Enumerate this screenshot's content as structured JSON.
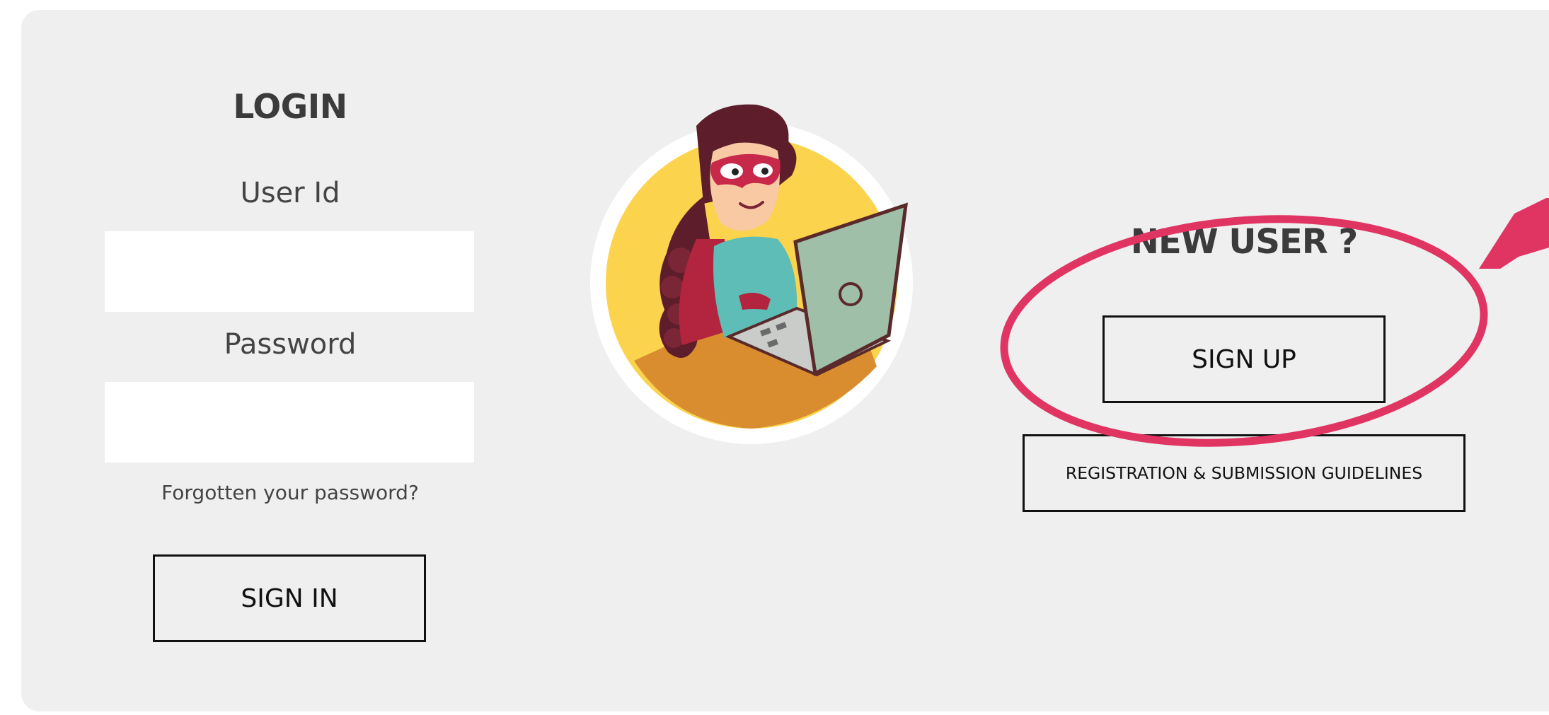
{
  "login": {
    "title": "LOGIN",
    "user_id_label": "User Id",
    "user_id_value": "",
    "password_label": "Password",
    "password_value": "",
    "forgot_password": "Forgotten your password?",
    "sign_in": "SIGN IN"
  },
  "new_user": {
    "title": "NEW USER ?",
    "sign_up": "SIGN UP",
    "guidelines": "REGISTRATION & SUBMISSION GUIDELINES"
  },
  "colors": {
    "panel_bg": "#efefef",
    "annotation": "#e03563",
    "avatar_circle": "#fbd34d",
    "button_border": "#111111"
  }
}
